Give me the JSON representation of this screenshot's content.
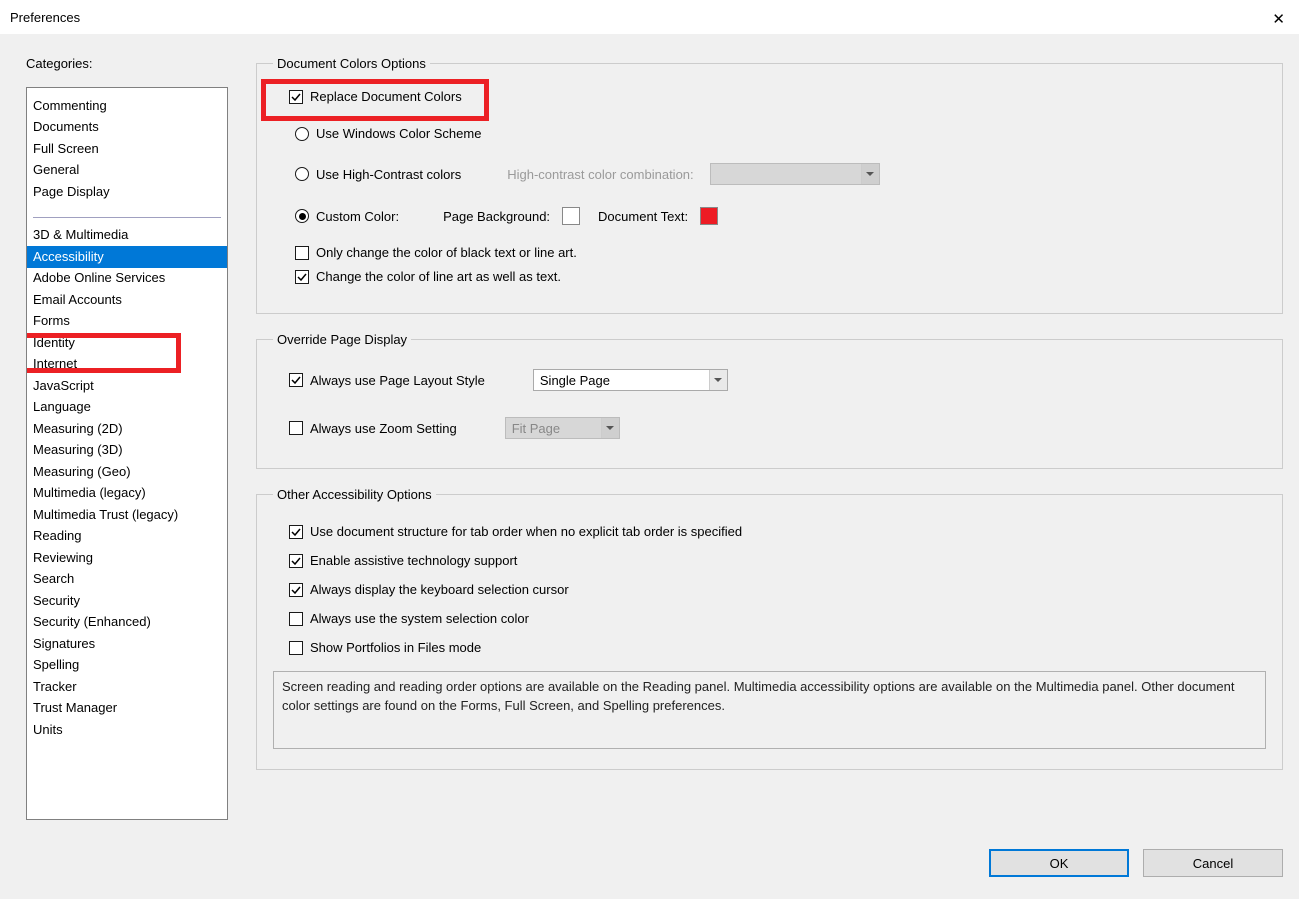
{
  "window": {
    "title": "Preferences"
  },
  "sidebar": {
    "label": "Categories:",
    "group1": [
      "Commenting",
      "Documents",
      "Full Screen",
      "General",
      "Page Display"
    ],
    "group2": [
      "3D & Multimedia",
      "Accessibility",
      "Adobe Online Services",
      "Email Accounts",
      "Forms",
      "Identity",
      "Internet",
      "JavaScript",
      "Language",
      "Measuring (2D)",
      "Measuring (3D)",
      "Measuring (Geo)",
      "Multimedia (legacy)",
      "Multimedia Trust (legacy)",
      "Reading",
      "Reviewing",
      "Search",
      "Security",
      "Security (Enhanced)",
      "Signatures",
      "Spelling",
      "Tracker",
      "Trust Manager",
      "Units"
    ],
    "selected": "Accessibility"
  },
  "groups": {
    "doc_colors": {
      "legend": "Document Colors Options",
      "replace": "Replace Document Colors",
      "use_windows": "Use Windows Color Scheme",
      "use_high_contrast": "Use High-Contrast colors",
      "hc_label": "High-contrast color combination:",
      "custom_color": "Custom Color:",
      "page_bg": "Page Background:",
      "doc_text": "Document Text:",
      "bg_swatch": "#ffffff",
      "text_swatch": "#ed1c24",
      "only_black": "Only change the color of black text or line art.",
      "change_lineart": "Change the color of line art as well as text."
    },
    "override": {
      "legend": "Override Page Display",
      "always_layout": "Always use Page Layout Style",
      "layout_value": "Single Page",
      "always_zoom": "Always use Zoom Setting",
      "zoom_value": "Fit Page"
    },
    "other": {
      "legend": "Other Accessibility Options",
      "tab_order": "Use document structure for tab order when no explicit tab order is specified",
      "assistive": "Enable assistive technology support",
      "kbd_cursor": "Always display the keyboard selection cursor",
      "sys_sel_color": "Always use the system selection color",
      "portfolios": "Show Portfolios in Files mode",
      "info": "Screen reading and reading order options are available on the Reading panel. Multimedia accessibility options are available on the Multimedia panel. Other document color settings are found on the Forms, Full Screen, and Spelling preferences."
    }
  },
  "buttons": {
    "ok": "OK",
    "cancel": "Cancel"
  }
}
